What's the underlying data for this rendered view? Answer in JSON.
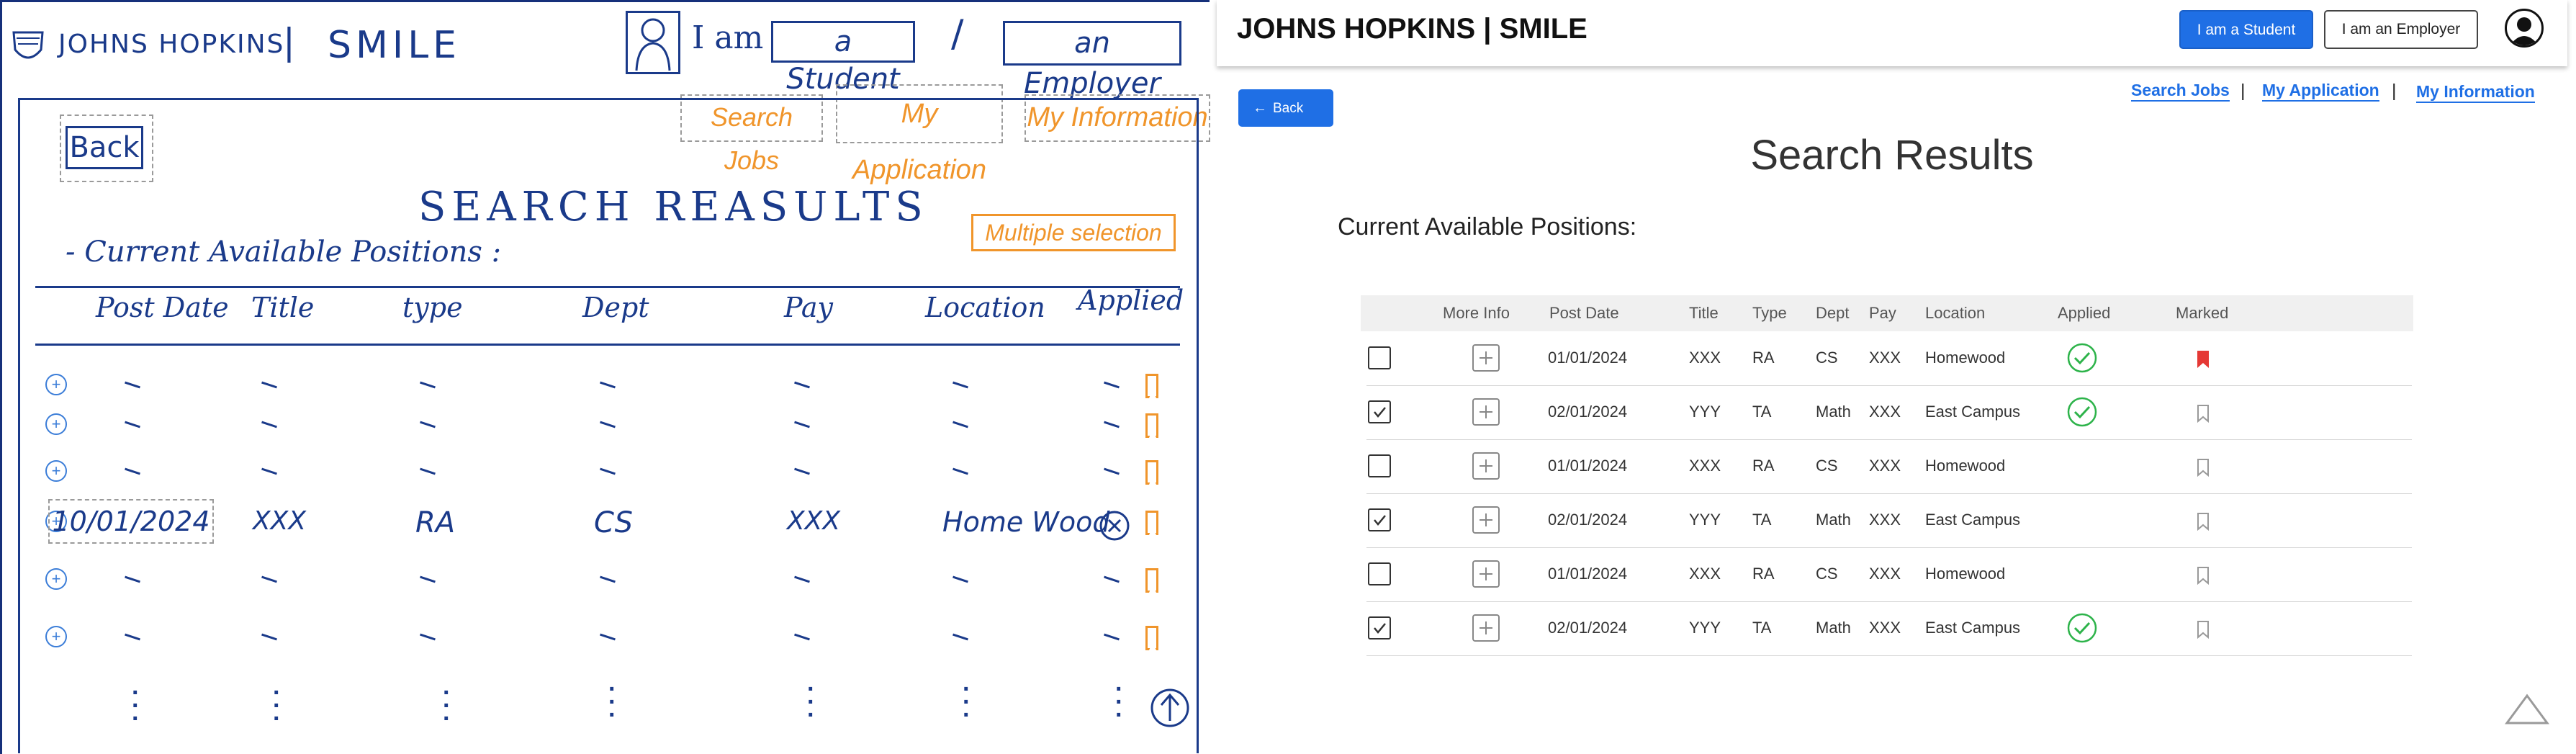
{
  "sketch": {
    "brand": "JOHNS HOPKINS",
    "brand_sep": "|",
    "brand_smile": "SMILE",
    "iam": "I am",
    "student": "a Student",
    "slash": "/",
    "employer": "an Employer",
    "nav": [
      "Search Jobs",
      "My Application",
      "My Information"
    ],
    "back": "Back",
    "title": "SEARCH REASULTS",
    "subtitle": "- Current Available Positions :",
    "multi": "Multiple selection",
    "columns": [
      "Post Date",
      "Title",
      "type",
      "Dept",
      "Pay",
      "Location",
      "Applied"
    ],
    "sample_row": [
      "10/01/2024",
      "XXX",
      "RA",
      "CS",
      "XXX",
      "Home Wood"
    ]
  },
  "ui": {
    "brand": "JOHNS HOPKINS | SMILE",
    "student_btn": "I am a Student",
    "employer_btn": "I am an Employer",
    "back": "Back",
    "nav": [
      "Search Jobs",
      "My Application",
      "My Information"
    ],
    "nav_sep": "|",
    "page_title": "Search Results",
    "subheading": "Current Available Positions:",
    "columns": [
      "More Info",
      "Post Date",
      "Title",
      "Type",
      "Dept",
      "Pay",
      "Location",
      "Applied",
      "Marked"
    ],
    "rows": [
      {
        "checked": false,
        "date": "01/01/2024",
        "title": "XXX",
        "type": "RA",
        "dept": "CS",
        "pay": "XXX",
        "location": "Homewood",
        "applied": true,
        "marked": true
      },
      {
        "checked": true,
        "date": "02/01/2024",
        "title": "YYY",
        "type": "TA",
        "dept": "Math",
        "pay": "XXX",
        "location": "East Campus",
        "applied": true,
        "marked": false
      },
      {
        "checked": false,
        "date": "01/01/2024",
        "title": "XXX",
        "type": "RA",
        "dept": "CS",
        "pay": "XXX",
        "location": "Homewood",
        "applied": false,
        "marked": false
      },
      {
        "checked": true,
        "date": "02/01/2024",
        "title": "YYY",
        "type": "TA",
        "dept": "Math",
        "pay": "XXX",
        "location": "East Campus",
        "applied": false,
        "marked": false
      },
      {
        "checked": false,
        "date": "01/01/2024",
        "title": "XXX",
        "type": "RA",
        "dept": "CS",
        "pay": "XXX",
        "location": "Homewood",
        "applied": false,
        "marked": false
      },
      {
        "checked": true,
        "date": "02/01/2024",
        "title": "YYY",
        "type": "TA",
        "dept": "Math",
        "pay": "XXX",
        "location": "East Campus",
        "applied": true,
        "marked": false
      }
    ],
    "colors": {
      "primary": "#1f6fe5",
      "applied": "#2db34a",
      "marked": "#e53935",
      "sketch_ink": "#1a3a8a",
      "sketch_accent": "#f0952b"
    }
  }
}
